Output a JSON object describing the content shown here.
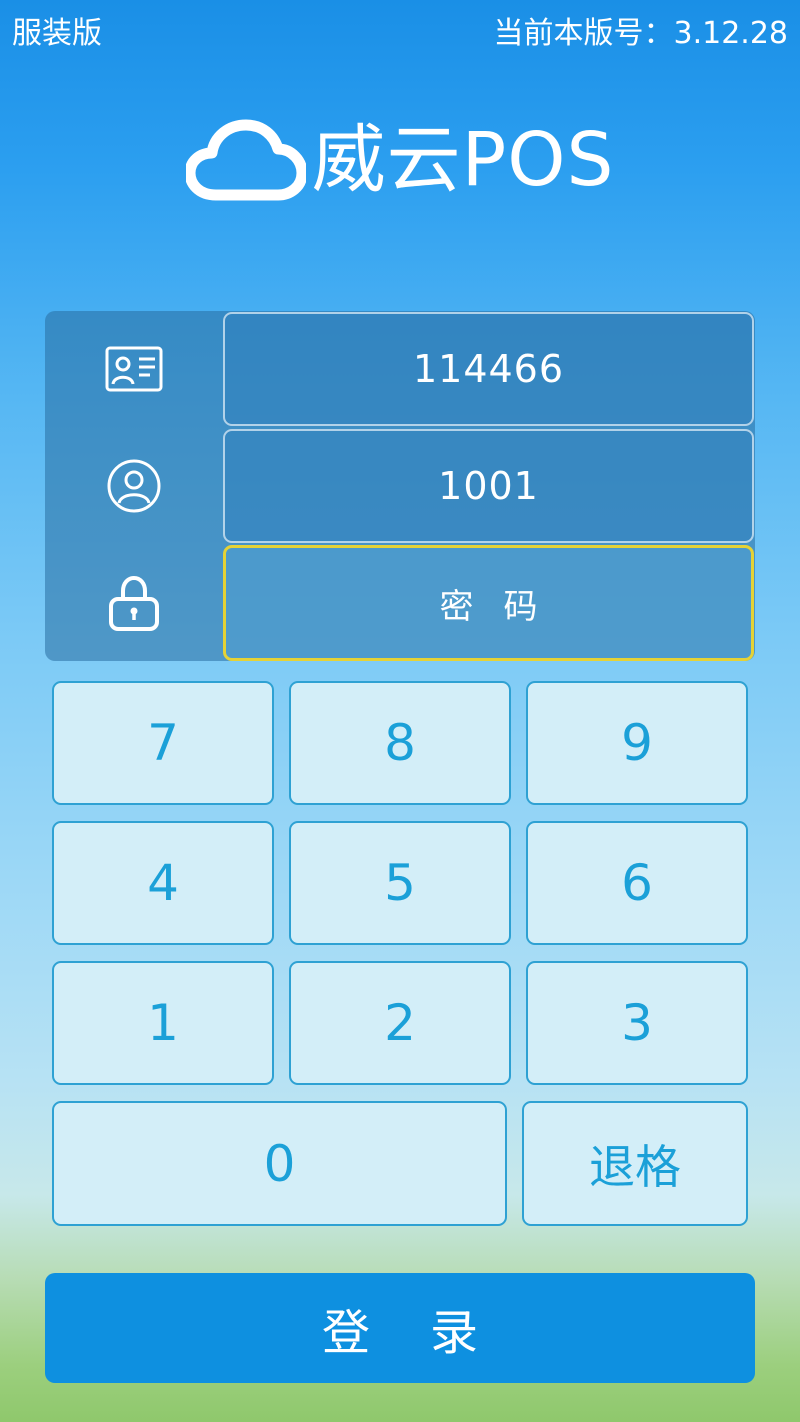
{
  "header": {
    "edition_label": "服装版",
    "version_label": "当前本版号：3.12.28"
  },
  "logo": {
    "icon": "cloud-icon",
    "text": "威云POS"
  },
  "form": {
    "store_id": {
      "icon": "id-card-icon",
      "value": "114466"
    },
    "user_id": {
      "icon": "user-icon",
      "value": "1001"
    },
    "password": {
      "icon": "lock-icon",
      "value": "",
      "placeholder": "密码"
    }
  },
  "keypad": {
    "keys": [
      "7",
      "8",
      "9",
      "4",
      "5",
      "6",
      "1",
      "2",
      "3",
      "0"
    ],
    "backspace_label": "退格"
  },
  "login_button": {
    "label": "登录"
  },
  "colors": {
    "key_text": "#1ba0d8",
    "key_border": "#2ea1d3",
    "key_bg": "#d3eef8",
    "login_bg": "#0e90e0",
    "active_border": "#e5d236"
  }
}
